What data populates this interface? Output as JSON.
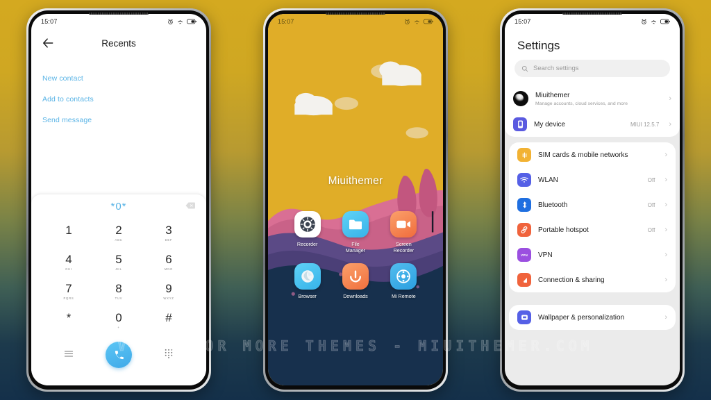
{
  "watermark": "VISIT FOR MORE THEMES - MIUITHEMER.COM",
  "theme": {
    "accent_blue": "#5ab4e6",
    "bg_gradient_top": "#d4a920",
    "bg_gradient_bottom": "#14304a",
    "wallpaper_sky": "#e0ad28"
  },
  "phones": {
    "left": {
      "status": {
        "time": "15:07",
        "icons": [
          "alarm-icon",
          "airplane-mode-icon",
          "battery-icon"
        ]
      },
      "header": {
        "back": "back-arrow-icon",
        "title": "Recents"
      },
      "links": [
        {
          "label": "New contact"
        },
        {
          "label": "Add to contacts"
        },
        {
          "label": "Send message"
        }
      ],
      "dialer": {
        "number": "*0*",
        "backspace": "backspace-icon",
        "keys": [
          {
            "digit": "1",
            "letters": ""
          },
          {
            "digit": "2",
            "letters": "ABC"
          },
          {
            "digit": "3",
            "letters": "DEF"
          },
          {
            "digit": "4",
            "letters": "GHI"
          },
          {
            "digit": "5",
            "letters": "JKL"
          },
          {
            "digit": "6",
            "letters": "MNO"
          },
          {
            "digit": "7",
            "letters": "PQRS"
          },
          {
            "digit": "8",
            "letters": "TUV"
          },
          {
            "digit": "9",
            "letters": "WXYZ"
          },
          {
            "digit": "*",
            "letters": ""
          },
          {
            "digit": "0",
            "letters": "+"
          },
          {
            "digit": "#",
            "letters": ""
          }
        ],
        "left_action": "menu-icon",
        "call_action": "call-icon",
        "right_action": "keypad-icon"
      }
    },
    "mid": {
      "status": {
        "time": "15:07",
        "icons": [
          "alarm-icon",
          "airplane-mode-icon",
          "battery-icon"
        ]
      },
      "home_label": "Miuithemer",
      "apps": [
        {
          "name": "Recorder",
          "icon": "recorder-icon",
          "color": "#ffffff"
        },
        {
          "name": "File\nManager",
          "icon": "file-manager-icon",
          "color": "#4cc3f0"
        },
        {
          "name": "Screen\nRecorder",
          "icon": "screen-recorder-icon",
          "color": "#f58a4b"
        },
        {
          "name": "Browser",
          "icon": "browser-icon",
          "color": "#4cc3f0"
        },
        {
          "name": "Downloads",
          "icon": "downloads-icon",
          "color": "#f58a4b"
        },
        {
          "name": "Mi Remote",
          "icon": "mi-remote-icon",
          "color": "#3aafe8"
        }
      ]
    },
    "right": {
      "status": {
        "time": "15:07",
        "icons": [
          "alarm-icon",
          "airplane-mode-icon",
          "battery-icon"
        ]
      },
      "title": "Settings",
      "search": {
        "placeholder": "Search settings",
        "icon": "search-icon"
      },
      "account_group": [
        {
          "title": "Miuithemer",
          "subtitle": "Manage accounts, cloud services, and more",
          "icon": "avatar",
          "value": "",
          "chevron": "›"
        },
        {
          "title": "My device",
          "subtitle": "",
          "icon": "my-device-icon",
          "icon_color": "#5a5ae0",
          "value": "MIUI 12.5.7",
          "chevron": "›"
        }
      ],
      "network_group": [
        {
          "title": "SIM cards & mobile networks",
          "icon": "sim-card-icon",
          "icon_color": "#f2b233",
          "value": "",
          "chevron": "›"
        },
        {
          "title": "WLAN",
          "icon": "wlan-icon",
          "icon_color": "#5560e6",
          "value": "Off",
          "chevron": "›"
        },
        {
          "title": "Bluetooth",
          "icon": "bluetooth-icon",
          "icon_color": "#1f6fe0",
          "value": "Off",
          "chevron": "›"
        },
        {
          "title": "Portable hotspot",
          "icon": "portable-hotspot-icon",
          "icon_color": "#f0633c",
          "value": "Off",
          "chevron": "›"
        },
        {
          "title": "VPN",
          "icon": "vpn-icon",
          "icon_color": "#9b4fe0",
          "value": "",
          "chevron": "›"
        },
        {
          "title": "Connection & sharing",
          "icon": "connection-sharing-icon",
          "icon_color": "#f0633c",
          "value": "",
          "chevron": "›"
        }
      ],
      "personalization_group": [
        {
          "title": "Wallpaper & personalization",
          "icon": "wallpaper-icon",
          "icon_color": "#5560e6",
          "value": "",
          "chevron": "›"
        }
      ]
    }
  }
}
